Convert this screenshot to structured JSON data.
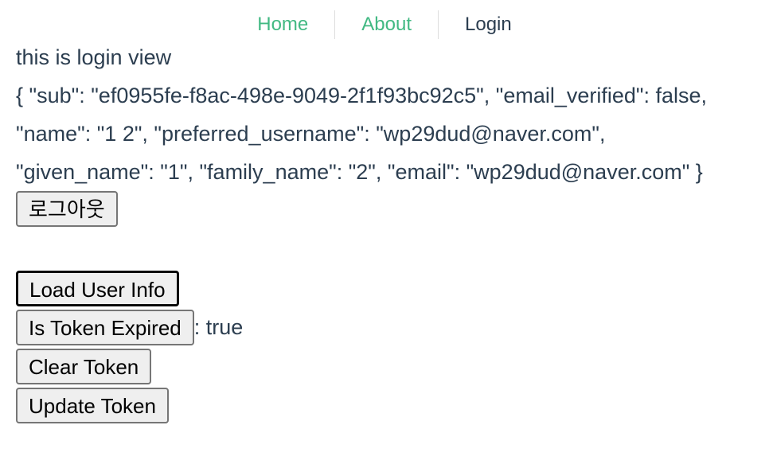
{
  "nav": {
    "home": "Home",
    "about": "About",
    "login": "Login"
  },
  "main": {
    "view_text": "this is login view",
    "user_json": "{ \"sub\": \"ef0955fe-f8ac-498e-9049-2f1f93bc92c5\", \"email_verified\": false, \"name\": \"1 2\", \"preferred_username\": \"wp29dud@naver.com\", \"given_name\": \"1\", \"family_name\": \"2\", \"email\": \"wp29dud@naver.com\" }",
    "logout_label": "로그아웃",
    "load_user_info_label": "Load User Info",
    "is_token_expired_label": "Is Token Expired",
    "token_expired_result": ": true",
    "clear_token_label": "Clear Token",
    "update_token_label": "Update Token"
  },
  "colors": {
    "nav_active": "#42b983",
    "text": "#2c3e50",
    "button_bg": "#efefef"
  }
}
